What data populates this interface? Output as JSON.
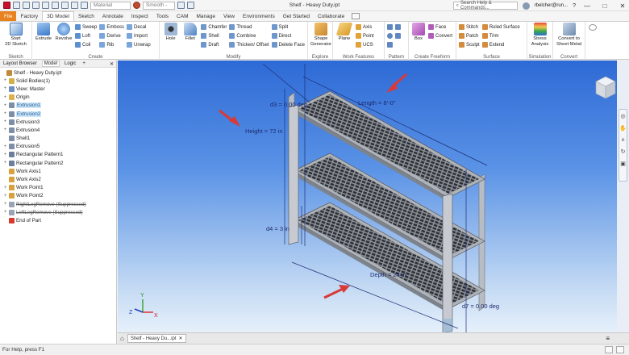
{
  "window": {
    "title": "Shelf - Heavy Duty.ipt",
    "material": "Material",
    "appearance": "Smooth - ",
    "search_placeholder": "Search Help & Commands...",
    "user": "rbelcher@run...",
    "minimize": "—",
    "maximize": "□",
    "close": "✕"
  },
  "tabs": [
    "File",
    "Factory",
    "3D Model",
    "Sketch",
    "Annotate",
    "Inspect",
    "Tools",
    "CAM",
    "Manage",
    "View",
    "Environments",
    "Get Started",
    "Collaborate"
  ],
  "active_tab": "3D Model",
  "ribbon": {
    "sketch": {
      "label": "Sketch",
      "start": "Start\n2D Sketch"
    },
    "create": {
      "label": "Create",
      "extrude": "Extrude",
      "revolve": "Revolve",
      "sweep": "Sweep",
      "loft": "Loft",
      "coil": "Coil",
      "emboss": "Emboss",
      "derive": "Derive",
      "rib": "Rib",
      "decal": "Decal",
      "import": "Import",
      "unwrap": "Unwrap"
    },
    "modify": {
      "label": "Modify",
      "hole": "Hole",
      "fillet": "Fillet",
      "chamfer": "Chamfer",
      "shell": "Shell",
      "draft": "Draft",
      "thread": "Thread",
      "combine": "Combine",
      "thicken": "Thicken/ Offset",
      "split": "Split",
      "direct": "Direct",
      "delete_face": "Delete Face"
    },
    "explore": {
      "label": "Explore",
      "shape_generator": "Shape\nGenerator"
    },
    "work_features": {
      "label": "Work Features",
      "plane": "Plane",
      "axis": "Axis",
      "point": "Point",
      "ucs": "UCS"
    },
    "pattern": {
      "label": "Pattern"
    },
    "freeform": {
      "label": "Create Freeform",
      "box": "Box",
      "face": "Face",
      "convert": "Convert"
    },
    "surface": {
      "label": "Surface",
      "stitch": "Stitch",
      "patch": "Patch",
      "sculpt": "Sculpt",
      "ruled": "Ruled Surface",
      "trim": "Trim",
      "extend": "Extend"
    },
    "simulation": {
      "label": "Simulation",
      "stress": "Stress\nAnalysis"
    },
    "convert": {
      "label": "Convert",
      "sheet_metal": "Convert to\nSheet Metal"
    }
  },
  "browser": {
    "tabs": [
      "Layout Browser",
      "Model",
      "Logic",
      "+"
    ],
    "active_tab": "Model",
    "close": "✕",
    "items": [
      {
        "label": "Shelf - Heavy Duty.ipt",
        "indent": 0,
        "exp": "",
        "icon": "#c18a3a",
        "state": ""
      },
      {
        "label": "Solid Bodies(1)",
        "indent": 1,
        "exp": "+",
        "icon": "#d2b04a",
        "state": ""
      },
      {
        "label": "View: Master",
        "indent": 1,
        "exp": "+",
        "icon": "#6b8fc2",
        "state": ""
      },
      {
        "label": "Origin",
        "indent": 1,
        "exp": "+",
        "icon": "#e0b14a",
        "state": ""
      },
      {
        "label": "Extrusion1",
        "indent": 1,
        "exp": "+",
        "icon": "#7c8ea8",
        "state": "sel"
      },
      {
        "label": "Extrusion2",
        "indent": 1,
        "exp": "+",
        "icon": "#7c8ea8",
        "state": "sel"
      },
      {
        "label": "Extrusion3",
        "indent": 1,
        "exp": "+",
        "icon": "#7c8ea8",
        "state": ""
      },
      {
        "label": "Extrusion4",
        "indent": 1,
        "exp": "+",
        "icon": "#7c8ea8",
        "state": ""
      },
      {
        "label": "Shell1",
        "indent": 1,
        "exp": "",
        "icon": "#7c8ea8",
        "state": ""
      },
      {
        "label": "Extrusion5",
        "indent": 1,
        "exp": "+",
        "icon": "#7c8ea8",
        "state": ""
      },
      {
        "label": "Rectangular Pattern1",
        "indent": 1,
        "exp": "+",
        "icon": "#6c7ea0",
        "state": ""
      },
      {
        "label": "Rectangular Pattern2",
        "indent": 1,
        "exp": "+",
        "icon": "#6c7ea0",
        "state": ""
      },
      {
        "label": "Work Axis1",
        "indent": 1,
        "exp": "",
        "icon": "#d9a13c",
        "state": ""
      },
      {
        "label": "Work Axis2",
        "indent": 1,
        "exp": "",
        "icon": "#d9a13c",
        "state": ""
      },
      {
        "label": "Work Point1",
        "indent": 1,
        "exp": "+",
        "icon": "#d9a13c",
        "state": ""
      },
      {
        "label": "Work Point2",
        "indent": 1,
        "exp": "+",
        "icon": "#d9a13c",
        "state": ""
      },
      {
        "label": "RightLegRemove (Suppressed)",
        "indent": 1,
        "exp": "+",
        "icon": "#9aa4b3",
        "state": "sup"
      },
      {
        "label": "LeftLegRemove (Suppressed)",
        "indent": 1,
        "exp": "+",
        "icon": "#9aa4b3",
        "state": "sup"
      },
      {
        "label": "End of Part",
        "indent": 1,
        "exp": "",
        "icon": "#d9382c",
        "state": ""
      }
    ]
  },
  "viewport": {
    "dim_d3": "d3 = 0.00 deg",
    "dim_length": "Length = 8'-0\"",
    "dim_height": "Height = 72 in",
    "dim_d4": "d4 = 3 in",
    "dim_depth": "Depth = 24 in",
    "dim_d7": "d7 = 0.00 deg",
    "triad": {
      "x": "X",
      "y": "Y",
      "z": "Z"
    }
  },
  "doc_tabs": {
    "home": "⌂",
    "active": "Shelf - Heavy Du...ipt",
    "close": "✕"
  },
  "status": {
    "text": "For Help, press F1"
  }
}
